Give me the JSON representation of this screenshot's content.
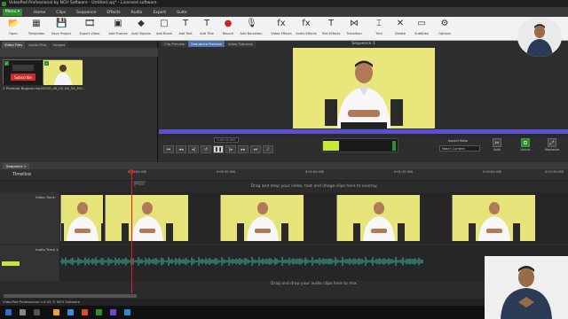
{
  "window": {
    "title": "VideoPad Professional by NCH Software - Untitled.vpj* - Licensed software"
  },
  "menu": {
    "button_label": "Menu ▾",
    "tabs": [
      "Home",
      "Clips",
      "Sequence",
      "Effects",
      "Audio",
      "Export",
      "Suite"
    ],
    "active_tab": "Home"
  },
  "toolbar": {
    "items": [
      {
        "label": "Open",
        "icon": "folder-open-icon"
      },
      {
        "label": "Templates",
        "icon": "templates-icon"
      },
      {
        "label": "Save Project",
        "icon": "save-icon"
      },
      {
        "label": "Export Video",
        "icon": "export-video-icon"
      },
      {
        "label": "Add Frames",
        "icon": "add-frames-icon"
      },
      {
        "label": "Add Objects",
        "icon": "add-objects-icon"
      },
      {
        "label": "Add Blank",
        "icon": "add-blank-icon"
      },
      {
        "label": "Add Text",
        "icon": "add-text-icon"
      },
      {
        "label": "Add Title",
        "icon": "add-title-icon"
      },
      {
        "label": "Record",
        "icon": "record-icon"
      },
      {
        "label": "Add Narration",
        "icon": "narration-icon"
      },
      {
        "label": "Video Effects",
        "icon": "video-effects-icon"
      },
      {
        "label": "Audio Effects",
        "icon": "audio-effects-icon"
      },
      {
        "label": "Text Effects",
        "icon": "text-effects-icon"
      },
      {
        "label": "Transition",
        "icon": "transition-icon"
      },
      {
        "label": "Trim",
        "icon": "trim-icon"
      },
      {
        "label": "Delete",
        "icon": "delete-icon"
      },
      {
        "label": "Subtitles",
        "icon": "subtitles-icon"
      },
      {
        "label": "Options",
        "icon": "options-icon"
      }
    ]
  },
  "media_panel": {
    "tabs": [
      "Video Files",
      "Audio Files",
      "Images"
    ],
    "active_tab": "Video Files",
    "clips": [
      {
        "name": "2 Promote Bogean.mp4",
        "overlay_text": "Subscribe"
      },
      {
        "name": "2020_06_02_08_54_MO..."
      }
    ]
  },
  "preview": {
    "tabs": [
      "Clip Preview",
      "Sequence Preview",
      "Video Tutorials"
    ],
    "active_tab": "Sequence Preview",
    "sequence_title": "Sequence 1",
    "timecode": "0:00:00.000",
    "aspect_label": "Aspect Ratio",
    "aspect_value": "Match Content",
    "side_tools": [
      "Split",
      "Unlink",
      "Maximize"
    ]
  },
  "timeline": {
    "sequence_tab": "Sequence 1",
    "label": "Timeline",
    "ruler": [
      "0:00:00.000",
      "0:00:30.000",
      "0:01:00.000",
      "0:01:30.000",
      "0:02:00.000",
      "0:02:30.000"
    ],
    "video_track_name": "Video Track",
    "audio_track_name": "Audio Track 1",
    "video_hint": "Drag and drop your video, text and image clips here to overlay.",
    "audio_hint": "Drag and drop your audio clips here to mix."
  },
  "status": {
    "text": "VideoPad Professional v 8.45 © NCH Software"
  },
  "colors": {
    "accent_green": "#2f8f2f",
    "scrub_bar": "#5a4fd0",
    "playhead": "#e02020",
    "waveform": "#3fb8a0",
    "frame_bg": "#e9e67c"
  }
}
